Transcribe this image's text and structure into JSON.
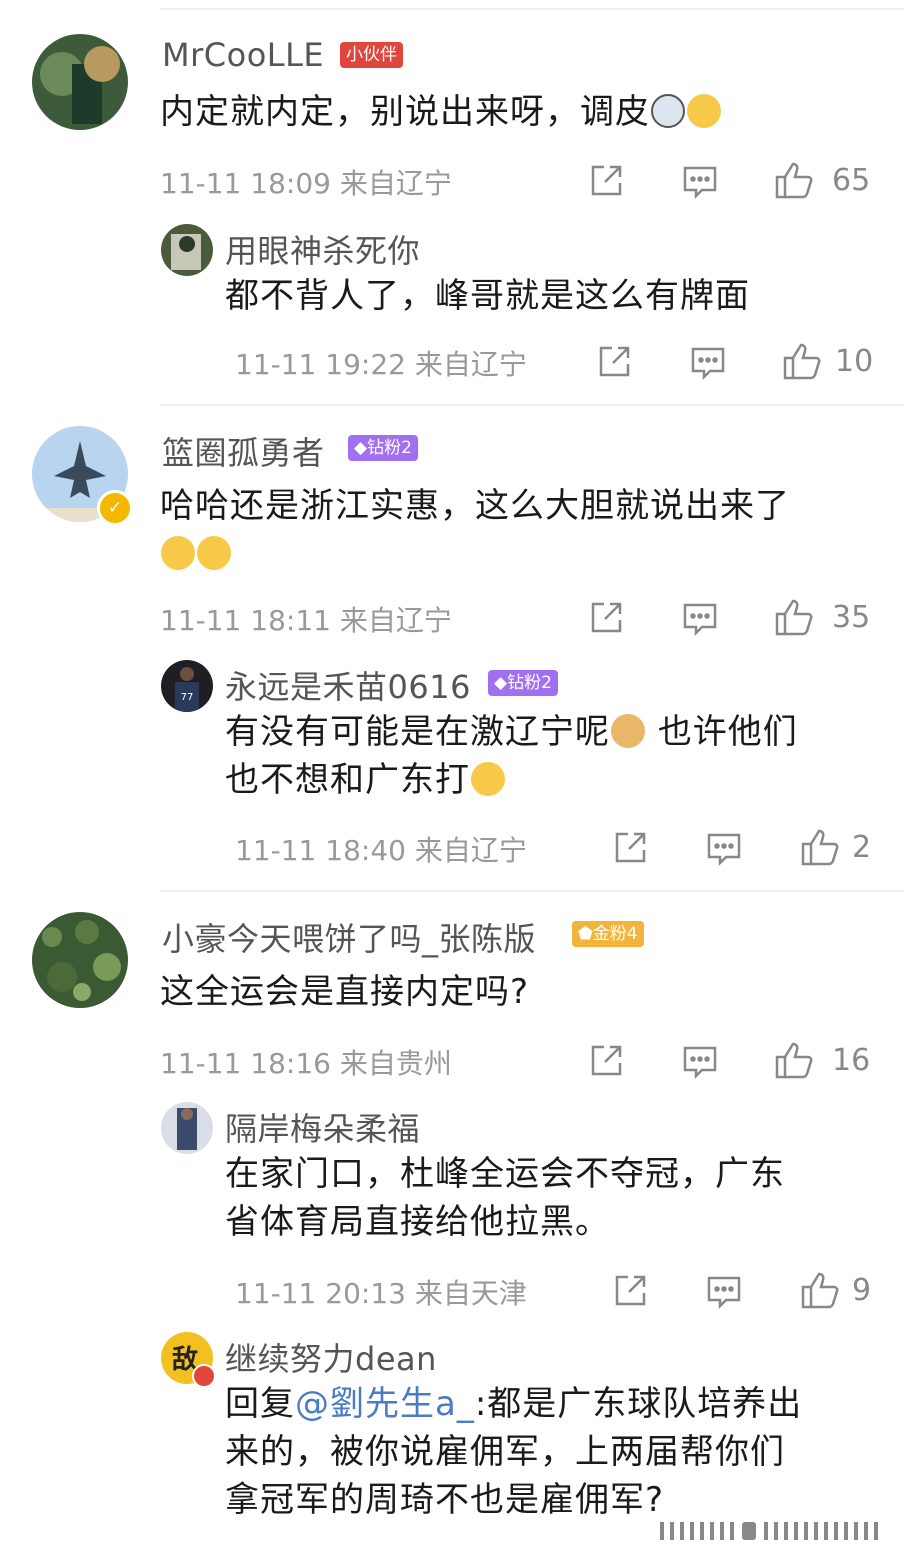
{
  "comments": [
    {
      "user": "MrCooLLE",
      "badge": "小伙伴",
      "text": "内定就内定，别说出来呀，调皮",
      "time": "11-11 18:09 来自辽宁",
      "likes": "65",
      "reply": {
        "user": "用眼神杀死你",
        "text": "都不背人了，峰哥就是这么有牌面",
        "time": "11-11 19:22 来自辽宁",
        "likes": "10"
      }
    },
    {
      "user": "篮圈孤勇者",
      "badge": "钻粉2",
      "text_line1": "哈哈还是浙江实惠，这么大胆就说出来了",
      "time": "11-11 18:11 来自辽宁",
      "likes": "35",
      "reply": {
        "user": "永远是禾苗0616",
        "badge": "钻粉2",
        "text_line1": "有没有可能是在激辽宁呢",
        "text_line1b": "也许他们",
        "text_line2": "也不想和广东打",
        "time": "11-11 18:40 来自辽宁",
        "likes": "2"
      }
    },
    {
      "user": "小豪今天喂饼了吗_张陈版",
      "badge": "金粉4",
      "text": "这全运会是直接内定吗?",
      "time": "11-11 18:16 来自贵州",
      "likes": "16",
      "reply": {
        "user": "隔岸梅朵柔福",
        "text_line1": "在家门口，杜峰全运会不夺冠，广东",
        "text_line2": "省体育局直接给他拉黑。",
        "time": "11-11 20:13 来自天津",
        "likes": "9"
      },
      "reply2": {
        "user": "继续努力dean",
        "prefix": "回复",
        "mention": "@劉先生a_",
        "text_line1": ":都是广东球队培养出",
        "text_line2": "来的，被你说雇佣军，上两届帮你们",
        "text_line3": "拿冠军的周琦不也是雇佣军?"
      }
    }
  ],
  "icons": [
    "share-icon",
    "comment-icon",
    "like-icon"
  ],
  "colors": {
    "accent": "#4a7bc7",
    "meta": "#999999",
    "badge_red": "#e0463b",
    "badge_purple": "#a070f0",
    "badge_gold": "#f2b43a"
  }
}
